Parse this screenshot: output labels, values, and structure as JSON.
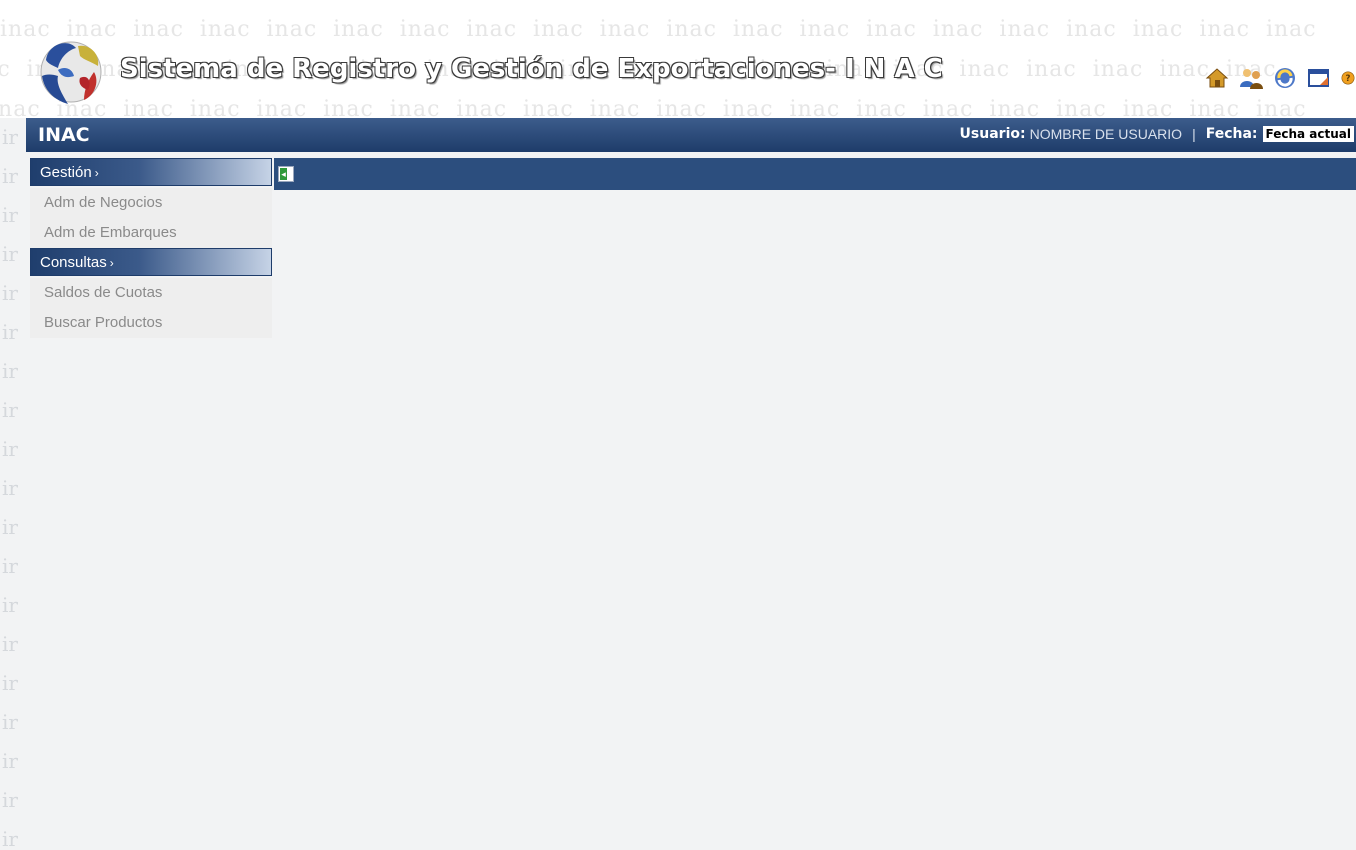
{
  "header": {
    "app_title": "Sistema de Registro y Gestión de Exportaciones- I N A C",
    "watermark_text": "inac",
    "logo_icon": "inac-logo",
    "toolbar_icons": [
      "home-icon",
      "users-icon",
      "refresh-icon",
      "window-icon",
      "help-icon"
    ]
  },
  "topbar": {
    "brand": "INAC",
    "user_label": "Usuario:",
    "user_value": "NOMBRE DE USUARIO",
    "separator": "|",
    "date_label": "Fecha:",
    "date_value": "Fecha actual"
  },
  "sidebar": {
    "sections": [
      {
        "title": "Gestión",
        "items": [
          "Adm de Negocios",
          "Adm de Embarques"
        ]
      },
      {
        "title": "Consultas",
        "items": [
          "Saldos de Cuotas",
          "Buscar Productos"
        ]
      }
    ]
  },
  "colors": {
    "header_bar": "#2c4e7e",
    "menu_header_dark": "#1f3e6d",
    "content_bg": "#f2f3f4"
  }
}
